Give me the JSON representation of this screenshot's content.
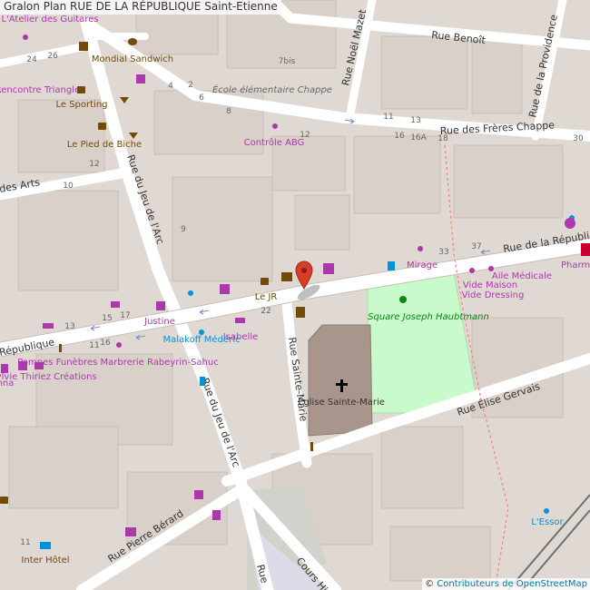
{
  "header": {
    "prefix": "Gralon",
    "title": "Plan RUE DE LA RÉPUBLIQUE",
    "city": "Saint-Etienne"
  },
  "attribution": {
    "symbol": "©",
    "link": "Contributeurs de OpenStreetMap"
  },
  "colors": {
    "street": "#ffffff",
    "building": "#d9d0c9",
    "block": "#e0d9d3",
    "park": "#c8facc",
    "poi_purple": "#ac39ac",
    "poi_brown": "#734a08",
    "poi_blue": "#0092da",
    "rail": "#707070",
    "marker": "#d63e2a"
  },
  "streets": {
    "republique_e": "Rue de la République",
    "republique_w": "République",
    "benoit": "Rue Benoît",
    "freres_chappe": "Rue des Frères Chappe",
    "noel_mazet": "Rue Noël Mazet",
    "providence": "Rue de la Providence",
    "jeu_arc_n": "Rue du Jeu de l'Arc",
    "jeu_arc_s": "Rue du Jeu de l'Arc",
    "sainte_marie": "Rue Sainte-Marie",
    "elise_gervais": "Rue Élise Gervais",
    "pierre_berard": "Rue Pierre Bérard",
    "arts": "des Arts",
    "cours_hippo": "Cours Hipp",
    "rue_s": "Rue"
  },
  "places": {
    "guitares": "L'Atelier des Guitares",
    "mondial": "Mondial Sandwich",
    "ecole": "École élémentaire Chappe",
    "espace": "Espace Rencontre Triangle",
    "sporting": "Le Sporting",
    "pied_biche": "Le Pied de Biche",
    "controle": "Contrôle ABG",
    "mirage": "Mirage",
    "aile": "Aile Médicale",
    "vide_maison": "Vide Maison",
    "vide_dressing": "Vide Dressing",
    "pharmacie": "Pharm Laza",
    "le_jr": "Le JR",
    "justine": "Justine",
    "malakoff": "Malakoff Médéric",
    "isabelle": "Isabelle",
    "square": "Square Joseph Haubtmann",
    "eglise": "Église Sainte-Marie",
    "pompes": "Pompes Funèbres Marbrerie Rabeyrin-Sahuc",
    "sylvie": "Sylvie Thiriez Créations",
    "inter": "Inter Hôtel",
    "essor": "L'Essor",
    "nna": "nna"
  },
  "house_numbers": [
    "26",
    "24",
    "4",
    "2",
    "6",
    "8",
    "7bis",
    "11",
    "13",
    "12",
    "16",
    "16A",
    "18",
    "30",
    "33",
    "37",
    "9",
    "10",
    "12",
    "15",
    "17",
    "13",
    "11",
    "22",
    "16",
    "11"
  ],
  "marker": {
    "name": "location-marker"
  }
}
